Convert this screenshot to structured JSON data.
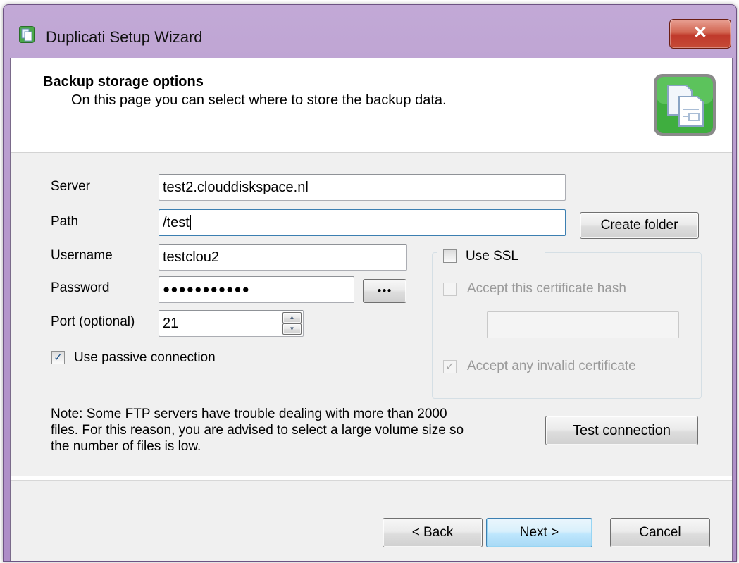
{
  "window": {
    "title": "Duplicati Setup Wizard",
    "close_glyph": "✕"
  },
  "header": {
    "title": "Backup storage options",
    "subtitle": "On this page you can select where to store the backup data.",
    "icon": "duplicati-documents-icon"
  },
  "form": {
    "server": {
      "label": "Server",
      "value": "test2.clouddiskspace.nl"
    },
    "path": {
      "label": "Path",
      "value": "/test"
    },
    "create_folder_label": "Create folder",
    "username": {
      "label": "Username",
      "value": "testclou2"
    },
    "password": {
      "label": "Password",
      "value": "●●●●●●●●●●●",
      "reveal_glyph": "●●●"
    },
    "port": {
      "label": "Port (optional)",
      "value": "21"
    },
    "passive": {
      "label": "Use passive connection",
      "checked": true
    },
    "ssl": {
      "label": "Use SSL",
      "checked": false,
      "accept_hash": {
        "label": "Accept this certificate hash",
        "checked": false,
        "enabled": false
      },
      "hash_value": "",
      "accept_any": {
        "label": "Accept any invalid certificate",
        "checked": true,
        "enabled": false
      }
    },
    "note": {
      "line1": "Note: Some FTP servers have trouble dealing with more than 2000",
      "line2": "files. For this reason, you are advised to select a large volume size so",
      "line3": "the number of files is low."
    },
    "test_connection_label": "Test connection"
  },
  "footer": {
    "back_label": "< Back",
    "next_label": "Next >",
    "cancel_label": "Cancel"
  },
  "glyphs": {
    "check": "✓",
    "spin_up": "▲",
    "spin_down": "▼"
  }
}
